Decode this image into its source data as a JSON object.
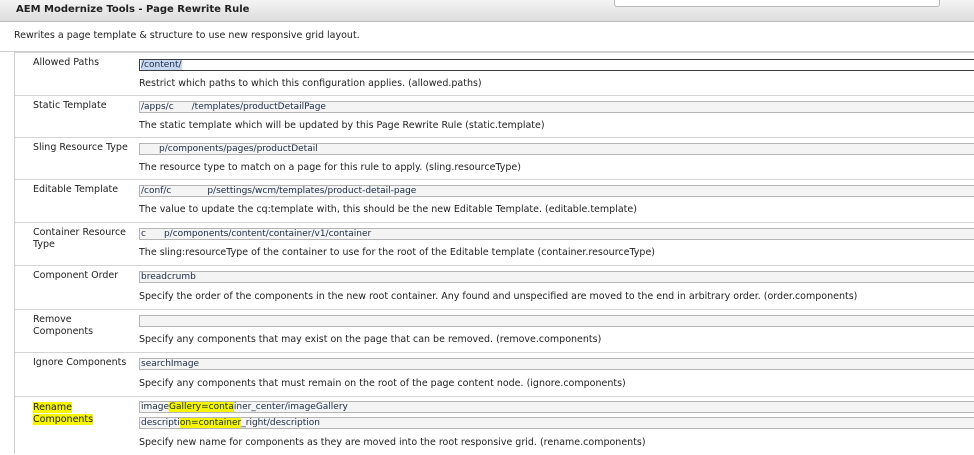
{
  "window": {
    "title": "AEM Modernize Tools - Page Rewrite Rule"
  },
  "description": "Rewrites a page template & structure to use new responsive grid layout.",
  "fields": {
    "allowed_paths": {
      "label": "Allowed Paths",
      "value": "/content/",
      "help": "Restrict which paths to which this configuration applies. (allowed.paths)"
    },
    "static_template": {
      "label": "Static Template",
      "value": "/apps/c  /templates/productDetailPage",
      "help": "The static template which will be updated by this Page Rewrite Rule (static.template)"
    },
    "sling_resource_type": {
      "label": "Sling Resource Type",
      "value": "  p/components/pages/productDetail",
      "help": "The resource type to match on a page for this rule to apply. (sling.resourceType)"
    },
    "editable_template": {
      "label": "Editable Template",
      "value": "/conf/c    p/settings/wcm/templates/product-detail-page",
      "help": "The value to update the cq:template with, this should be the new Editable Template. (editable.template)"
    },
    "container_resource_type": {
      "label": "Container Resource Type",
      "value": "c  p/components/content/container/v1/container",
      "help": "The sling:resourceType of the container to use for the root of the Editable template (container.resourceType)"
    },
    "component_order": {
      "label": "Component Order",
      "value": "breadcrumb",
      "help": "Specify the order of the components in the new root container. Any found and unspecified are moved to the end in arbitrary order. (order.components)"
    },
    "remove_components": {
      "label": "Remove Components",
      "value": "",
      "help": "Specify any components that may exist on the page that can be removed. (remove.components)"
    },
    "ignore_components": {
      "label": "Ignore Components",
      "value": "searchImage",
      "help": "Specify any components that must remain on the root of the page content node. (ignore.components)"
    },
    "rename_components": {
      "label": "Rename Components",
      "values": [
        {
          "pre": "image",
          "hl": "Gallery=conta",
          "post": "iner_center/imageGallery"
        },
        {
          "pre": "descripti",
          "hl": "on=container",
          "post": "_right/description"
        }
      ],
      "help": "Specify new name for components as they are moved into the root responsive grid. (rename.components)"
    }
  }
}
